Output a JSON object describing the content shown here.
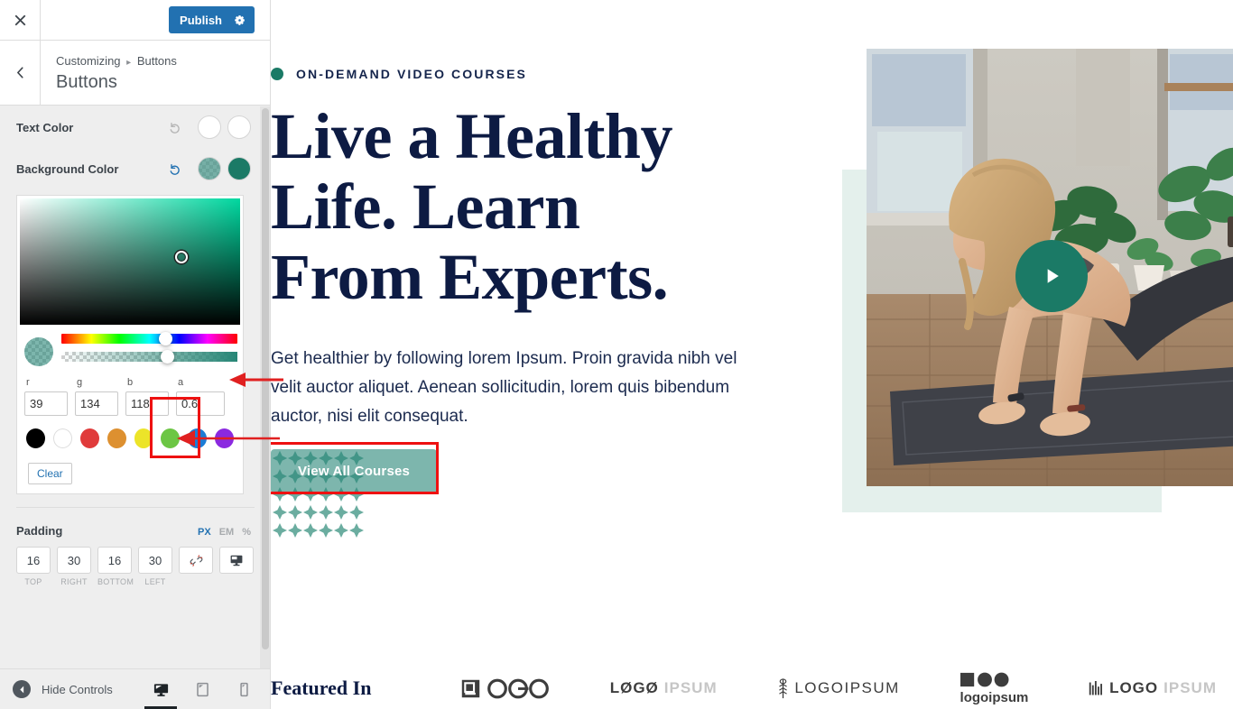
{
  "customizer": {
    "close_label": "Close",
    "publish_label": "Publish",
    "gear_label": "settings-gear",
    "breadcrumb_parent": "Customizing",
    "breadcrumb_separator": "▸",
    "breadcrumb_current": "Buttons",
    "section_title": "Buttons",
    "controls": [
      {
        "label": "Text Color",
        "swatch_a": "#ffffff",
        "swatch_b": "#ffffff",
        "reset": "undo-icon"
      },
      {
        "label": "Background Color",
        "swatch_a": "rgba(39,134,118,0.6)",
        "swatch_b": "#1b7a66",
        "reset": "undo-icon"
      }
    ],
    "picker": {
      "hue_position_pct": 59,
      "alpha_position_pct": 60,
      "saturation_base": "#00d8a0",
      "rgba": [
        {
          "label": "r",
          "value": "39"
        },
        {
          "label": "g",
          "value": "134"
        },
        {
          "label": "b",
          "value": "118"
        },
        {
          "label": "a",
          "value": "0.6"
        }
      ],
      "presets": [
        "#000000",
        "#ffffff",
        "#e03b3b",
        "#dd9030",
        "#ece429",
        "#6cc644",
        "#1c7cd6",
        "#8b29e0"
      ],
      "clear_label": "Clear"
    },
    "padding": {
      "title": "Padding",
      "units": [
        {
          "label": "PX",
          "active": true
        },
        {
          "label": "EM",
          "active": false
        },
        {
          "label": "%",
          "active": false
        }
      ],
      "fields": [
        {
          "value": "16",
          "side": "TOP"
        },
        {
          "value": "30",
          "side": "RIGHT"
        },
        {
          "value": "16",
          "side": "BOTTOM"
        },
        {
          "value": "30",
          "side": "LEFT"
        }
      ],
      "link_icon": "broken-link-icon",
      "device_icon": "desktop-icon"
    },
    "footer": {
      "hide_controls_label": "Hide Controls",
      "devices": [
        {
          "name": "desktop",
          "active": true
        },
        {
          "name": "tablet",
          "active": false
        },
        {
          "name": "mobile",
          "active": false
        }
      ]
    }
  },
  "preview": {
    "eyebrow": "ON-DEMAND VIDEO COURSES",
    "title": "Live a Healthy Life. Learn From Experts.",
    "paragraph": "Get healthier by following lorem Ipsum. Proin gravida nibh vel velit auctor aliquet. Aenean sollicitudin, lorem quis bibendum auctor, nisi elit consequat.",
    "cta_label": "View All Courses",
    "play_label": "play-button",
    "featured_label": "Featured In",
    "logos": [
      {
        "name": "logo-1",
        "text": "OGO"
      },
      {
        "name": "logo-2",
        "text_dark": "LØGØ",
        "text_light": "IPSUM"
      },
      {
        "name": "logo-3",
        "text": "LOGOIPSUM"
      },
      {
        "name": "logo-4",
        "text": "logoipsum"
      },
      {
        "name": "logo-5",
        "text_dark": "LOGO",
        "text_light": "IPSUM"
      }
    ],
    "colors": {
      "accent": "#1b7a66",
      "heading": "#0d1b43",
      "mint": "#e4f0ec",
      "button_bg": "rgba(39,134,118,0.6)",
      "dots": "#6bada0"
    }
  }
}
